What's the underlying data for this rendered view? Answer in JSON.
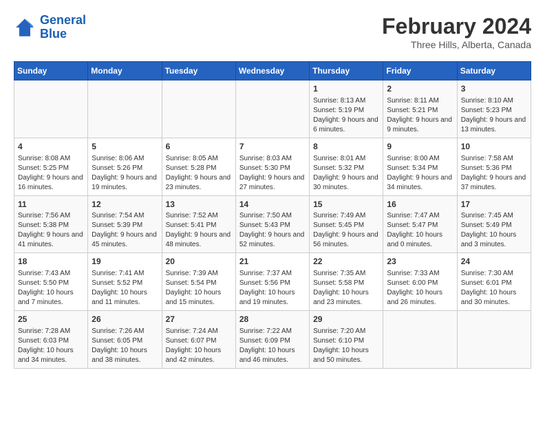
{
  "logo": {
    "line1": "General",
    "line2": "Blue"
  },
  "title": "February 2024",
  "subtitle": "Three Hills, Alberta, Canada",
  "days_header": [
    "Sunday",
    "Monday",
    "Tuesday",
    "Wednesday",
    "Thursday",
    "Friday",
    "Saturday"
  ],
  "weeks": [
    [
      {
        "num": "",
        "info": ""
      },
      {
        "num": "",
        "info": ""
      },
      {
        "num": "",
        "info": ""
      },
      {
        "num": "",
        "info": ""
      },
      {
        "num": "1",
        "info": "Sunrise: 8:13 AM\nSunset: 5:19 PM\nDaylight: 9 hours and 6 minutes."
      },
      {
        "num": "2",
        "info": "Sunrise: 8:11 AM\nSunset: 5:21 PM\nDaylight: 9 hours and 9 minutes."
      },
      {
        "num": "3",
        "info": "Sunrise: 8:10 AM\nSunset: 5:23 PM\nDaylight: 9 hours and 13 minutes."
      }
    ],
    [
      {
        "num": "4",
        "info": "Sunrise: 8:08 AM\nSunset: 5:25 PM\nDaylight: 9 hours and 16 minutes."
      },
      {
        "num": "5",
        "info": "Sunrise: 8:06 AM\nSunset: 5:26 PM\nDaylight: 9 hours and 19 minutes."
      },
      {
        "num": "6",
        "info": "Sunrise: 8:05 AM\nSunset: 5:28 PM\nDaylight: 9 hours and 23 minutes."
      },
      {
        "num": "7",
        "info": "Sunrise: 8:03 AM\nSunset: 5:30 PM\nDaylight: 9 hours and 27 minutes."
      },
      {
        "num": "8",
        "info": "Sunrise: 8:01 AM\nSunset: 5:32 PM\nDaylight: 9 hours and 30 minutes."
      },
      {
        "num": "9",
        "info": "Sunrise: 8:00 AM\nSunset: 5:34 PM\nDaylight: 9 hours and 34 minutes."
      },
      {
        "num": "10",
        "info": "Sunrise: 7:58 AM\nSunset: 5:36 PM\nDaylight: 9 hours and 37 minutes."
      }
    ],
    [
      {
        "num": "11",
        "info": "Sunrise: 7:56 AM\nSunset: 5:38 PM\nDaylight: 9 hours and 41 minutes."
      },
      {
        "num": "12",
        "info": "Sunrise: 7:54 AM\nSunset: 5:39 PM\nDaylight: 9 hours and 45 minutes."
      },
      {
        "num": "13",
        "info": "Sunrise: 7:52 AM\nSunset: 5:41 PM\nDaylight: 9 hours and 48 minutes."
      },
      {
        "num": "14",
        "info": "Sunrise: 7:50 AM\nSunset: 5:43 PM\nDaylight: 9 hours and 52 minutes."
      },
      {
        "num": "15",
        "info": "Sunrise: 7:49 AM\nSunset: 5:45 PM\nDaylight: 9 hours and 56 minutes."
      },
      {
        "num": "16",
        "info": "Sunrise: 7:47 AM\nSunset: 5:47 PM\nDaylight: 10 hours and 0 minutes."
      },
      {
        "num": "17",
        "info": "Sunrise: 7:45 AM\nSunset: 5:49 PM\nDaylight: 10 hours and 3 minutes."
      }
    ],
    [
      {
        "num": "18",
        "info": "Sunrise: 7:43 AM\nSunset: 5:50 PM\nDaylight: 10 hours and 7 minutes."
      },
      {
        "num": "19",
        "info": "Sunrise: 7:41 AM\nSunset: 5:52 PM\nDaylight: 10 hours and 11 minutes."
      },
      {
        "num": "20",
        "info": "Sunrise: 7:39 AM\nSunset: 5:54 PM\nDaylight: 10 hours and 15 minutes."
      },
      {
        "num": "21",
        "info": "Sunrise: 7:37 AM\nSunset: 5:56 PM\nDaylight: 10 hours and 19 minutes."
      },
      {
        "num": "22",
        "info": "Sunrise: 7:35 AM\nSunset: 5:58 PM\nDaylight: 10 hours and 23 minutes."
      },
      {
        "num": "23",
        "info": "Sunrise: 7:33 AM\nSunset: 6:00 PM\nDaylight: 10 hours and 26 minutes."
      },
      {
        "num": "24",
        "info": "Sunrise: 7:30 AM\nSunset: 6:01 PM\nDaylight: 10 hours and 30 minutes."
      }
    ],
    [
      {
        "num": "25",
        "info": "Sunrise: 7:28 AM\nSunset: 6:03 PM\nDaylight: 10 hours and 34 minutes."
      },
      {
        "num": "26",
        "info": "Sunrise: 7:26 AM\nSunset: 6:05 PM\nDaylight: 10 hours and 38 minutes."
      },
      {
        "num": "27",
        "info": "Sunrise: 7:24 AM\nSunset: 6:07 PM\nDaylight: 10 hours and 42 minutes."
      },
      {
        "num": "28",
        "info": "Sunrise: 7:22 AM\nSunset: 6:09 PM\nDaylight: 10 hours and 46 minutes."
      },
      {
        "num": "29",
        "info": "Sunrise: 7:20 AM\nSunset: 6:10 PM\nDaylight: 10 hours and 50 minutes."
      },
      {
        "num": "",
        "info": ""
      },
      {
        "num": "",
        "info": ""
      }
    ]
  ]
}
